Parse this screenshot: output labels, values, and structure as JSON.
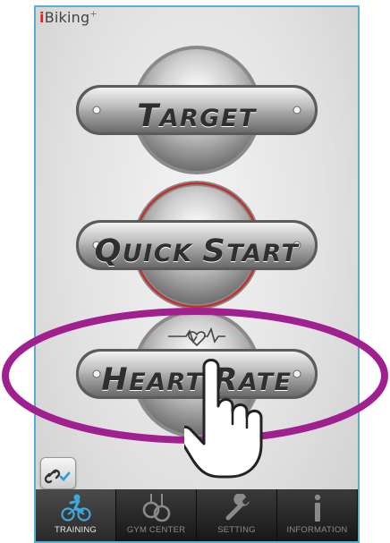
{
  "app": {
    "logo_i": "i",
    "logo_rest": "Biking",
    "logo_mark": "+"
  },
  "buttons": [
    {
      "cap": "T",
      "rest": "arget",
      "name": "target"
    },
    {
      "cap": "Q",
      "rest": "uick ",
      "cap2": "S",
      "rest2": "tart",
      "name": "quick-start"
    },
    {
      "cap": "H",
      "rest": "eart ",
      "cap2": "R",
      "rest2": "ate",
      "name": "heart-rate"
    }
  ],
  "tabs": [
    {
      "label": "TRAINING",
      "icon": "cyclist-icon",
      "active": true
    },
    {
      "label": "GYM CENTER",
      "icon": "gym-rings-icon",
      "active": false
    },
    {
      "label": "SETTING",
      "icon": "wrench-icon",
      "active": false
    },
    {
      "label": "INFORMATION",
      "icon": "info-icon",
      "active": false
    }
  ],
  "colors": {
    "annotation": "#a0208f",
    "phone_border": "#5aaecf",
    "cyclist": "#3fa8dc",
    "heart_ring": "#c0322f"
  }
}
